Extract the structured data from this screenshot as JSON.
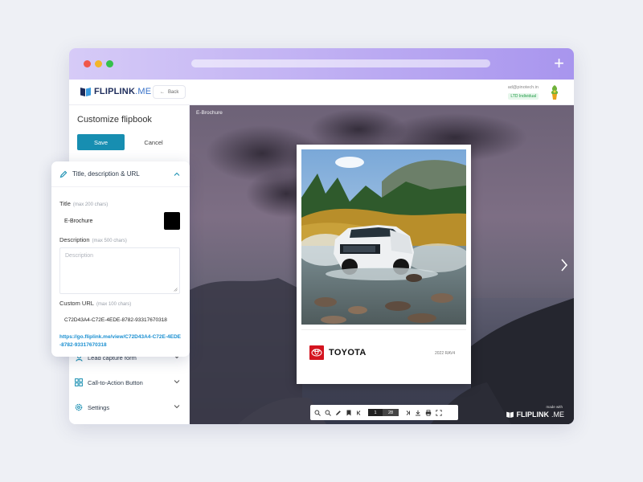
{
  "app": {
    "brand": "FLIPLINK",
    "brand_suffix": ".ME",
    "back_label": "Back",
    "user_email": "ad@pinotech.in",
    "plan": "LTD Individual"
  },
  "sidebar": {
    "title": "Customize flipbook",
    "save_label": "Save",
    "cancel_label": "Cancel",
    "items": [
      {
        "label": "Lead capture form",
        "icon": "user-icon"
      },
      {
        "label": "Call-to-Action Button",
        "icon": "cta-icon"
      },
      {
        "label": "Settings",
        "icon": "gear-icon"
      }
    ]
  },
  "panel": {
    "header": "Title, description & URL",
    "title_label": "Title",
    "title_hint": "(max 200 chars)",
    "title_value": "E-Brochure",
    "title_color": "#000000",
    "desc_label": "Description",
    "desc_hint": "(max 500 chars)",
    "desc_placeholder": "Description",
    "url_label": "Custom URL",
    "url_hint": "(max 100 chars)",
    "url_value": "C72D43A4-C72E-4EDE-8782-93317670318",
    "link": "https://go.fliplink.me/view/C72D43A4-C72E-4EDE-8782-93317670318"
  },
  "preview": {
    "label": "E-Brochure",
    "book_brand": "TOYOTA",
    "book_year": "2022 RAV4",
    "made_with": "made with",
    "footer_brand": "FLIPLINK",
    "footer_suffix": ".ME"
  },
  "toolbar": {
    "page_current": "1",
    "page_total": "28"
  },
  "colors": {
    "accent": "#178eb1",
    "link": "#1a8fd1",
    "toyota_red": "#d4141f"
  }
}
